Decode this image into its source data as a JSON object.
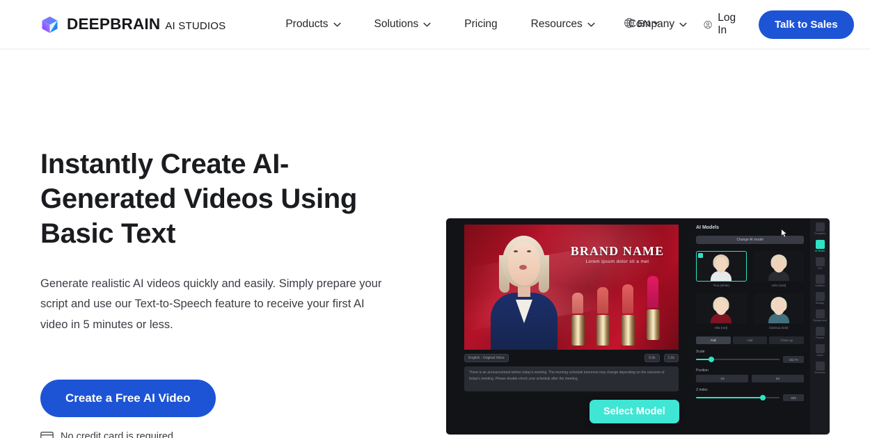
{
  "header": {
    "brand": {
      "name": "DEEPBRAIN",
      "suffix": "AI STUDIOS",
      "icon": "deepbrain-cube-logo"
    },
    "nav": [
      {
        "label": "Products",
        "has_dropdown": true
      },
      {
        "label": "Solutions",
        "has_dropdown": true
      },
      {
        "label": "Pricing",
        "has_dropdown": false
      },
      {
        "label": "Resources",
        "has_dropdown": true
      },
      {
        "label": "Company",
        "has_dropdown": true
      }
    ],
    "language": {
      "label": "EN",
      "icon": "globe-icon"
    },
    "login": {
      "label": "Log In",
      "icon": "user-circle-icon"
    },
    "cta": {
      "label": "Talk to Sales",
      "color": "#1d54d6"
    }
  },
  "hero": {
    "title": "Instantly Create AI-Generated Videos Using Basic Text",
    "subtitle": "Generate realistic AI videos quickly and easily. Simply prepare your script and use our Text-to-Speech feature to receive your first AI video in 5 minutes or less.",
    "cta": {
      "label": "Create a Free AI Video",
      "color": "#1d54d6"
    },
    "note": {
      "label": "No credit card is required",
      "icon": "credit-card-icon"
    }
  },
  "mockup": {
    "stage": {
      "brand_title": "BRAND NAME",
      "brand_subtitle": "Lorem ipsum dolor sit a met"
    },
    "toolbar": {
      "voice_chip": "English - Original Voice",
      "duration_chip": "0.3s",
      "speed_chip": "1.0x"
    },
    "script": "There is an announcement before today's meeting. The morning schedule tomorrow may change depending on the outcome of today's meeting. Please double-check your schedule after the meeting.",
    "panel": {
      "title": "AI Models",
      "change_button": "Change AI model",
      "models": [
        {
          "label": "Tina (white)",
          "selected": true
        },
        {
          "label": "John (suit)",
          "selected": false
        },
        {
          "label": "Mia (red)",
          "selected": false
        },
        {
          "label": "Clarissa (teal)",
          "selected": false
        }
      ],
      "tabs": [
        {
          "label": "Full",
          "active": true
        },
        {
          "label": "Half",
          "active": false
        },
        {
          "label": "Close up",
          "active": false
        }
      ],
      "controls": [
        {
          "label": "Scale",
          "value": "141 %"
        },
        {
          "label": "Position",
          "x": "-24",
          "y": "63"
        },
        {
          "label": "Z-index",
          "value": "404"
        }
      ]
    },
    "rail": [
      {
        "label": "Templates",
        "icon": "templates-icon",
        "active": false
      },
      {
        "label": "AI Model",
        "icon": "ai-model-icon",
        "active": true
      },
      {
        "label": "Text",
        "icon": "text-icon",
        "active": false
      },
      {
        "label": "Subtitles",
        "icon": "subtitles-icon",
        "active": false
      },
      {
        "label": "Storage",
        "icon": "storage-icon",
        "active": false
      },
      {
        "label": "Background",
        "icon": "background-icon",
        "active": false
      },
      {
        "label": "Frames",
        "icon": "frames-icon",
        "active": false
      },
      {
        "label": "Audio",
        "icon": "audio-icon",
        "active": false
      },
      {
        "label": "Elements",
        "icon": "elements-icon",
        "active": false
      }
    ],
    "select_model_button": {
      "label": "Select Model",
      "color": "#3fe6d4"
    }
  }
}
